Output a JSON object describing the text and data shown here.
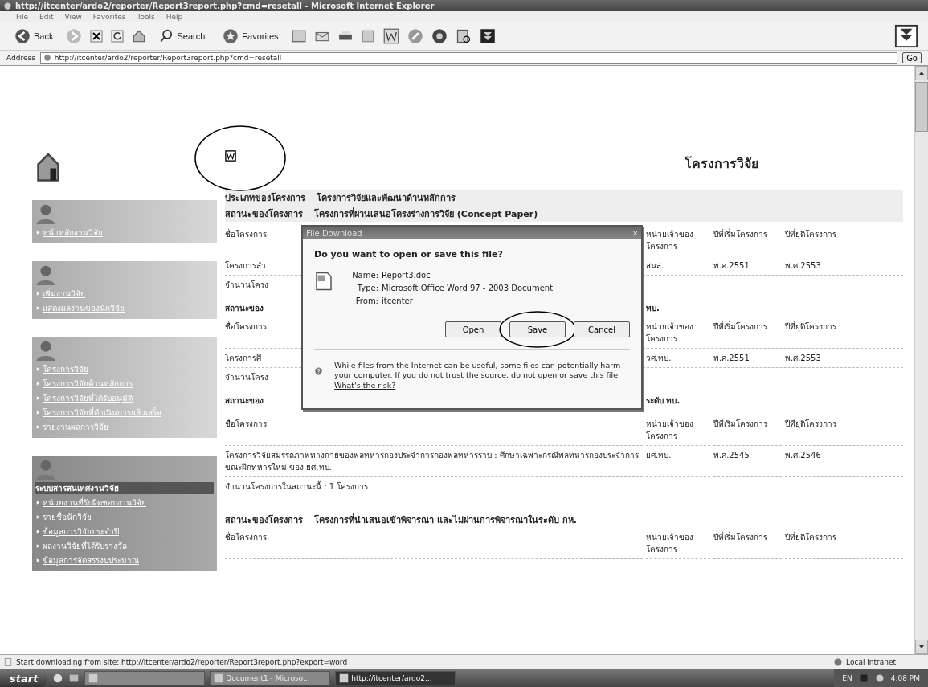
{
  "window": {
    "title": "http://itcenter/ardo2/reporter/Report3report.php?cmd=resetall - Microsoft Internet Explorer"
  },
  "menu": [
    "File",
    "Edit",
    "View",
    "Favorites",
    "Tools",
    "Help"
  ],
  "toolbar": {
    "back": "Back",
    "search": "Search",
    "favorites": "Favorites"
  },
  "address_bar": {
    "label": "Address",
    "value": "http://itcenter/ardo2/reporter/Report3report.php?cmd=resetall",
    "go": "Go"
  },
  "sidebar": {
    "groups": [
      {
        "links": [
          "หน้าหลักงานวิจัย"
        ]
      },
      {
        "links": [
          "เพิ่มงานวิจัย",
          "แสดงผลงานของนักวิจัย"
        ]
      },
      {
        "links": [
          "โครงการวิจัย",
          "โครงการวิจัยด้านหลักการ",
          "โครงการวิจัยที่ได้รับอนุมัติ",
          "โครงการวิจัยที่ดำเนินการแล้วเสร็จ",
          "รายงานผลการวิจัย"
        ]
      },
      {
        "heading": "ระบบสารสนเทศงานวิจัย",
        "links": [
          "หน่วยงานที่รับผิดชอบงานวิจัย",
          "รายชื่อนักวิจัย",
          "ข้อมูลการวิจัยประจำปี",
          "ผลงานวิจัยที่ได้รับรางวัล",
          "ข้อมูลการจัดสรรงบประมาณ"
        ]
      }
    ]
  },
  "page": {
    "title": "โครงการวิจัย",
    "project_type": {
      "label": "ประเภทของโครงการ",
      "value": "โครงการวิจัยและพัฒนาด้านหลักการ"
    },
    "first_status": {
      "label": "สถานะของโครงการ",
      "value": "โครงการที่ผ่านเสนอโครงร่างการวิจัย (Concept Paper)"
    },
    "covered_rows": [
      {
        "kind": "header",
        "left": "ชื่อโครงการ",
        "cells": [
          "หน่วยเจ้าของโครงการ",
          "ปีที่เริ่มโครงการ",
          "ปีที่ยุติโครงการ"
        ]
      },
      {
        "kind": "row",
        "left": "โครงการสำ",
        "cells": [
          "สนส.",
          "พ.ศ.2551",
          "พ.ศ.2553"
        ]
      },
      {
        "kind": "count",
        "left": "จำนวนโครง",
        "cells": []
      },
      {
        "kind": "heading",
        "left": "สถานะของ",
        "cells": [
          "ทบ."
        ]
      },
      {
        "kind": "header",
        "left": "ชื่อโครงการ",
        "cells": [
          "หน่วยเจ้าของโครงการ",
          "ปีที่เริ่มโครงการ",
          "ปีที่ยุติโครงการ"
        ]
      },
      {
        "kind": "row",
        "left": "โครงการศึ",
        "cells": [
          "วศ.ทบ.",
          "พ.ศ.2551",
          "พ.ศ.2553"
        ]
      },
      {
        "kind": "count",
        "left": "จำนวนโครง",
        "cells": []
      },
      {
        "kind": "heading",
        "left": "สถานะของ",
        "cells": [
          "ระดับ ทบ."
        ]
      }
    ],
    "sections": [
      {
        "columns": [
          "ชื่อโครงการ",
          "หน่วยเจ้าของโครงการ",
          "ปีที่เริ่มโครงการ",
          "ปีที่ยุติโครงการ"
        ],
        "rows": [
          {
            "cells": [
              "โครงการวิจัยสมรรถภาพทางกายของพลทหารกองประจำการกองพลทหารราบ : ศึกษาเฉพาะกรณีพลทหารกองประจำการขณะฝึกทหารใหม่ ของ ยศ.ทบ.",
              "ยศ.ทบ.",
              "พ.ศ.2545",
              "พ.ศ.2546"
            ]
          }
        ],
        "count": "จำนวนโครงการในสถานะนี้ : 1 โครงการ"
      },
      {
        "status_label": "สถานะของโครงการ",
        "status": "โครงการที่นำเสนอเข้าพิจารณา และไม่ผ่านการพิจารณาในระดับ กห.",
        "columns": [
          "ชื่อโครงการ",
          "หน่วยเจ้าของโครงการ",
          "ปีที่เริ่มโครงการ",
          "ปีที่ยุติโครงการ"
        ]
      }
    ]
  },
  "dialog": {
    "title": "File Download",
    "close": "×",
    "question": "Do you want to open or save this file?",
    "fields": [
      {
        "label": "Name:",
        "value": "Report3.doc"
      },
      {
        "label": "Type:",
        "value": "Microsoft Office Word 97 - 2003 Document"
      },
      {
        "label": "From:",
        "value": "itcenter"
      }
    ],
    "buttons": [
      {
        "label": "Open",
        "circled": false
      },
      {
        "label": "Save",
        "circled": true
      },
      {
        "label": "Cancel",
        "circled": false
      }
    ],
    "warning": "While files from the Internet can be useful, some files can potentially harm your computer. If you do not trust the source, do not open or save this file.",
    "risk_link": "What's the risk?"
  },
  "status_bar": {
    "text": "Start downloading from site: http://itcenter/ardo2/reporter/Report3report.php?export=word",
    "zone": "Local intranet"
  },
  "taskbar": {
    "start": "start",
    "tasks": [
      {
        "selected": false
      },
      {
        "label": "Document1 - Microso...",
        "selected": false
      },
      {
        "label": "http://itcenter/ardo2...",
        "selected": true
      }
    ],
    "language": "EN",
    "clock": "4:08 PM"
  }
}
